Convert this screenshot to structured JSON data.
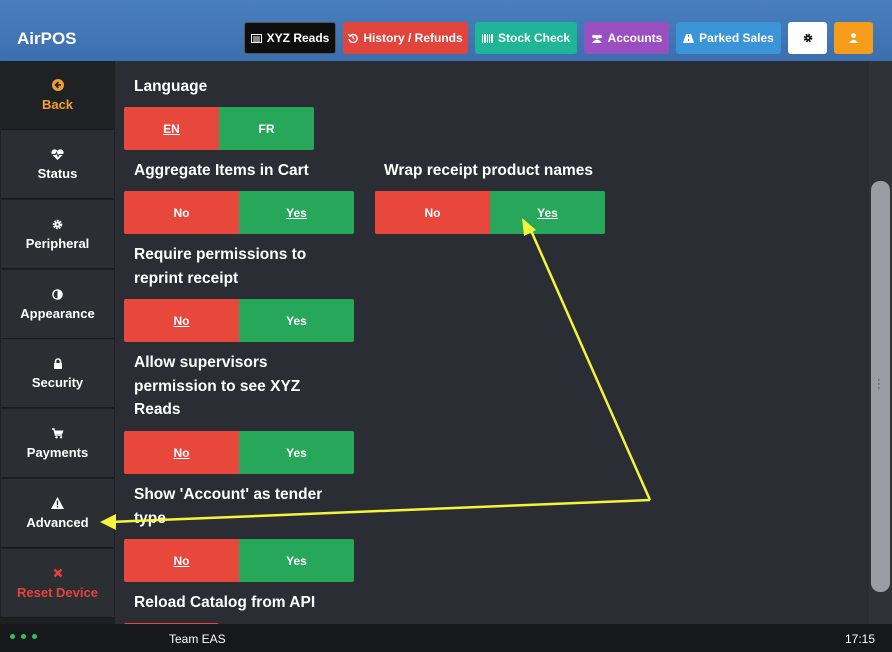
{
  "header": {
    "app_title": "AirPOS",
    "buttons": [
      {
        "label": "XYZ Reads",
        "icon": "report-icon",
        "color": "#0e0e0e"
      },
      {
        "label": "History / Refunds",
        "icon": "history-icon",
        "color": "#e0443b"
      },
      {
        "label": "Stock Check",
        "icon": "barcode-icon",
        "color": "#1fb597"
      },
      {
        "label": "Accounts",
        "icon": "users-icon",
        "color": "#9a4fc0"
      },
      {
        "label": "Parked Sales",
        "icon": "road-icon",
        "color": "#3a94d8"
      },
      {
        "label": "",
        "icon": "gear-icon",
        "color": "#ffffff"
      },
      {
        "label": "",
        "icon": "user-icon",
        "color": "#f59d1a"
      }
    ]
  },
  "sidebar": {
    "items": [
      {
        "label": "Back",
        "icon": "arrow-left-circle-icon"
      },
      {
        "label": "Status",
        "icon": "heartbeat-icon"
      },
      {
        "label": "Peripheral",
        "icon": "gear-icon"
      },
      {
        "label": "Appearance",
        "icon": "contrast-icon"
      },
      {
        "label": "Security",
        "icon": "lock-icon"
      },
      {
        "label": "Payments",
        "icon": "cart-icon"
      },
      {
        "label": "Advanced",
        "icon": "warning-icon"
      },
      {
        "label": "Reset Device",
        "icon": "close-icon"
      }
    ]
  },
  "settings": {
    "language": {
      "label": "Language",
      "options": [
        "EN",
        "FR"
      ],
      "selected": "EN"
    },
    "aggregate": {
      "label": "Aggregate Items in Cart",
      "options": [
        "No",
        "Yes"
      ],
      "selected": "Yes"
    },
    "wrap": {
      "label": "Wrap receipt product names",
      "options": [
        "No",
        "Yes"
      ],
      "selected": "Yes"
    },
    "reprint": {
      "label_lines": [
        "Require permissions to",
        "reprint receipt"
      ],
      "options": [
        "No",
        "Yes"
      ],
      "selected": "No"
    },
    "supervisors": {
      "label_lines": [
        "Allow supervisors",
        "permission to see XYZ",
        "Reads"
      ],
      "options": [
        "No",
        "Yes"
      ],
      "selected": "No"
    },
    "account_tender": {
      "label_lines": [
        "Show 'Account' as tender",
        "type"
      ],
      "options": [
        "No",
        "Yes"
      ],
      "selected": "No"
    },
    "reload_catalog": {
      "label": "Reload Catalog from API"
    }
  },
  "footer": {
    "team": "Team EAS",
    "time": "17:15"
  },
  "colors": {
    "header": "#3f74b4",
    "no": "#e8483c",
    "yes": "#27a75a",
    "annotation": "#f4f43a"
  }
}
